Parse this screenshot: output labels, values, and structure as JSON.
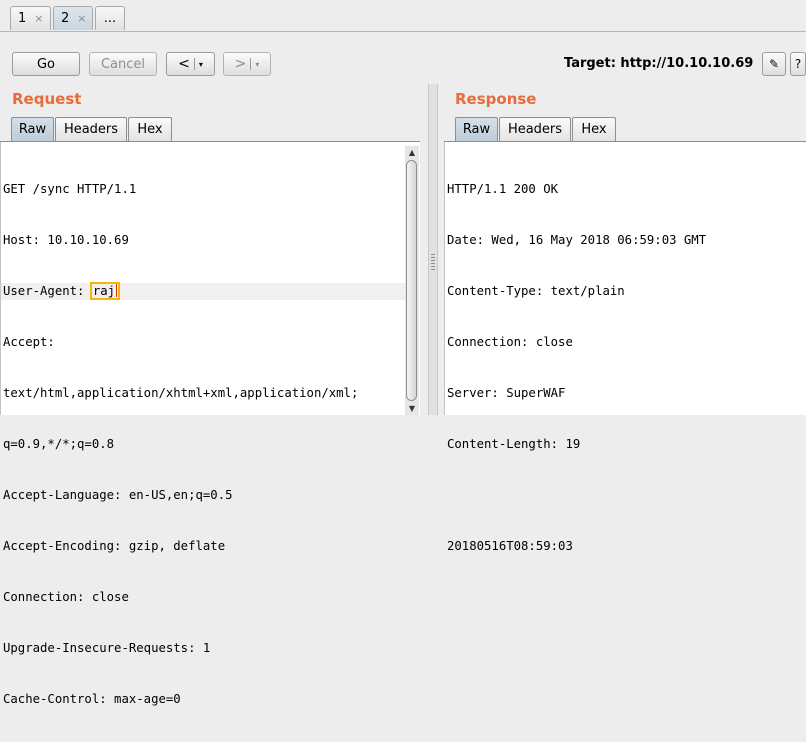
{
  "tabs": [
    {
      "label": "1",
      "close": "×"
    },
    {
      "label": "2",
      "close": "×"
    },
    {
      "label": "..."
    }
  ],
  "toolbar": {
    "go_label": "Go",
    "cancel_label": "Cancel",
    "back_label": "<",
    "forward_label": ">",
    "dropdown_glyph": "▾",
    "target_label": "Target: http://10.10.10.69",
    "edit_icon": "✎",
    "help_icon": "?"
  },
  "request": {
    "heading": "Request",
    "tabs": [
      "Raw",
      "Headers",
      "Hex"
    ],
    "lines": [
      "GET /sync HTTP/1.1",
      "Host: 10.10.10.69",
      "User-Agent: ",
      "Accept:",
      "text/html,application/xhtml+xml,application/xml;",
      "q=0.9,*/*;q=0.8",
      "Accept-Language: en-US,en;q=0.5",
      "Accept-Encoding: gzip, deflate",
      "Connection: close",
      "Upgrade-Insecure-Requests: 1",
      "Cache-Control: max-age=0"
    ],
    "user_agent_value": "raj"
  },
  "response": {
    "heading": "Response",
    "tabs": [
      "Raw",
      "Headers",
      "Hex"
    ],
    "lines": [
      "HTTP/1.1 200 OK",
      "Date: Wed, 16 May 2018 06:59:03 GMT",
      "Content-Type: text/plain",
      "Connection: close",
      "Server: SuperWAF",
      "Content-Length: 19",
      "",
      "20180516T08:59:03"
    ]
  },
  "scrollbar": {
    "up_arrow": "▲",
    "down_arrow": "▼"
  },
  "colors": {
    "accent": "#e86b3a",
    "focus_outline": "#f5b800",
    "caret": "#e1261c"
  }
}
